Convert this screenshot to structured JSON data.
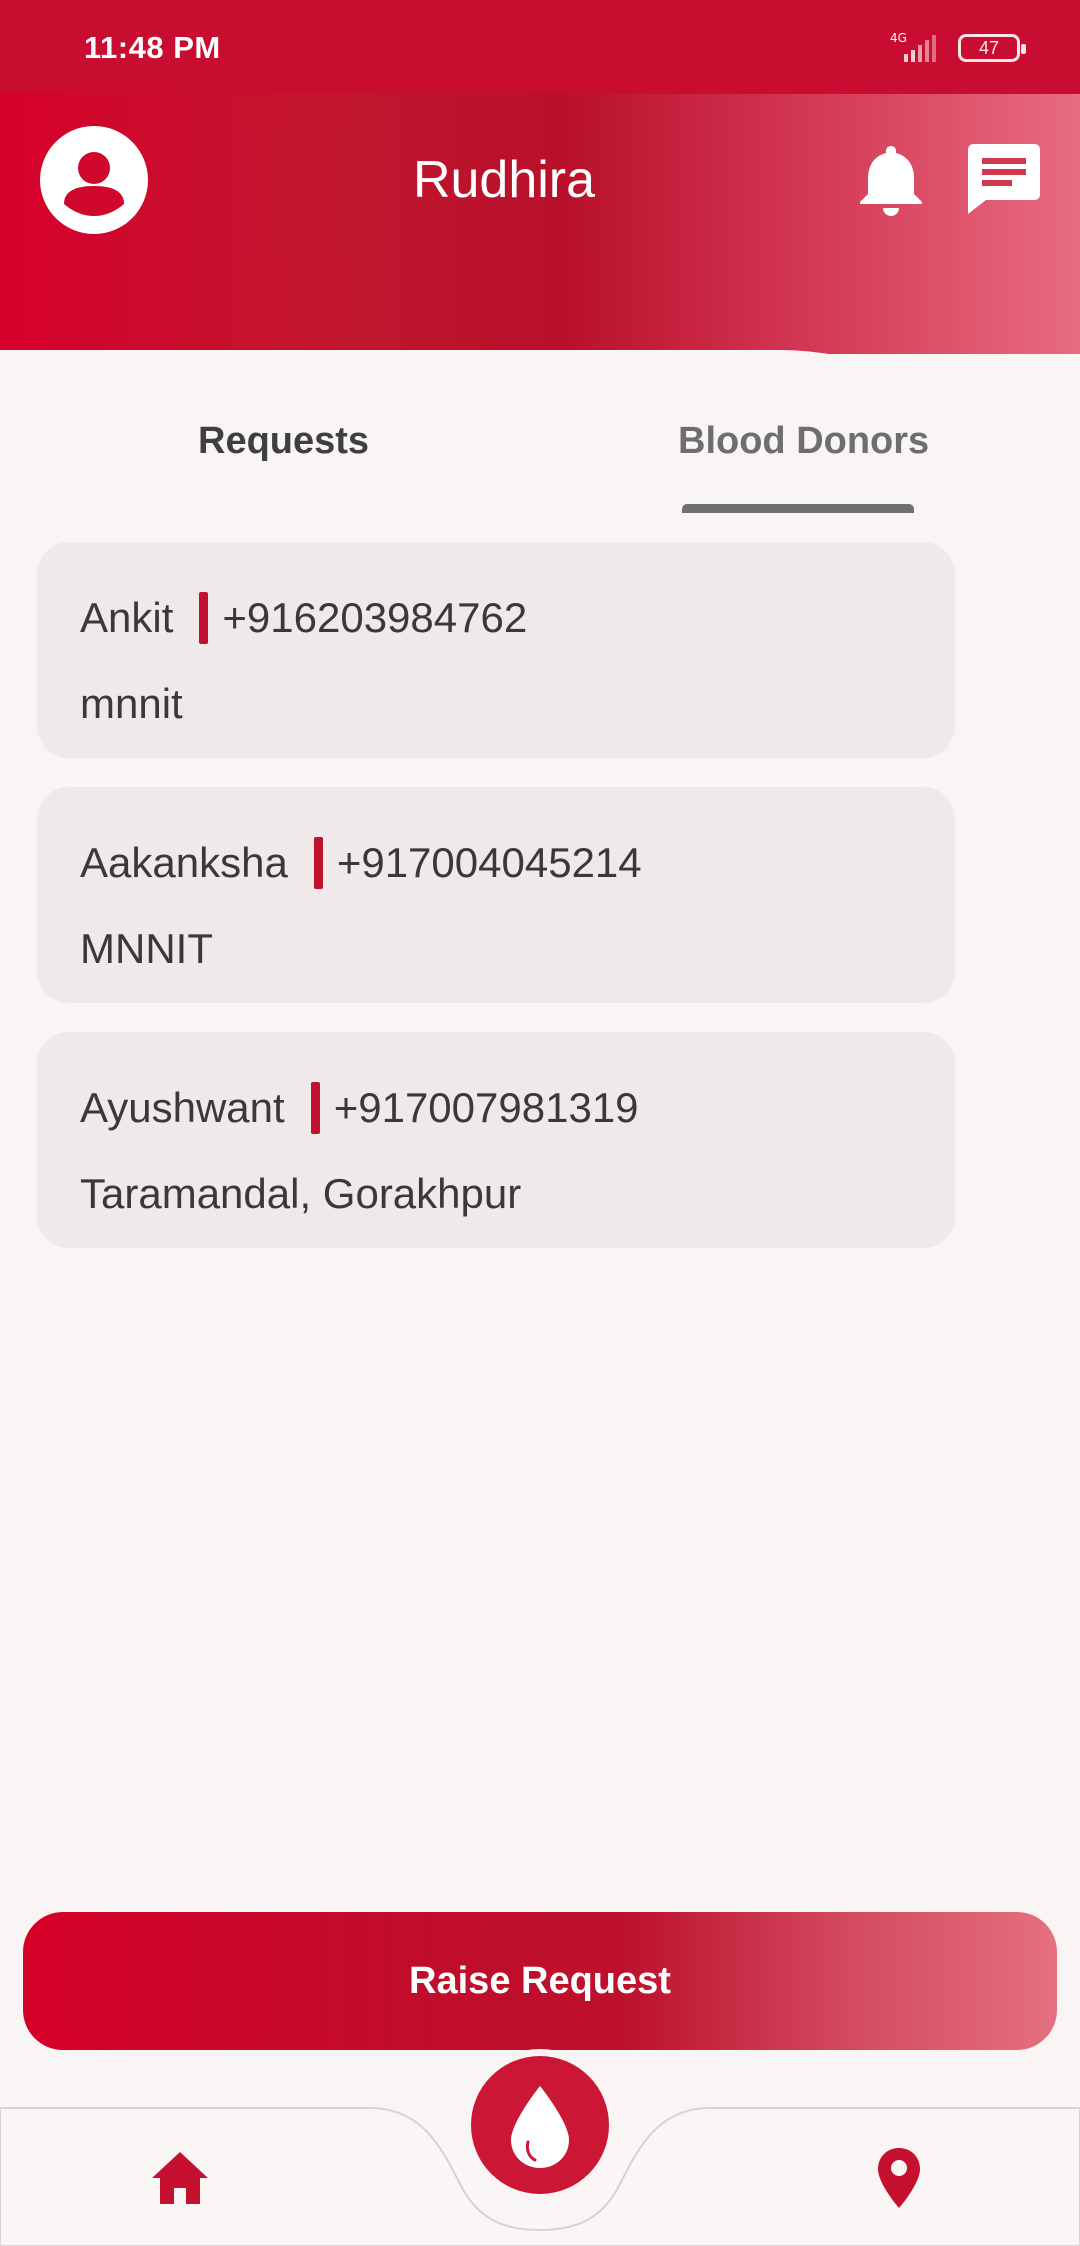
{
  "status_bar": {
    "time": "11:48 PM",
    "network": "4G",
    "battery": "47"
  },
  "header": {
    "title": "Rudhira",
    "avatar_icon": "user-avatar-icon",
    "notification_icon": "bell-icon",
    "message_icon": "chat-icon"
  },
  "tabs": [
    {
      "label": "Requests",
      "selected": false
    },
    {
      "label": "Blood Donors",
      "selected": true
    }
  ],
  "requests": [
    {
      "name": "Ankit",
      "phone": "+916203984762",
      "location": "mnnit"
    },
    {
      "name": "Aakanksha",
      "phone": "+917004045214",
      "location": "MNNIT"
    },
    {
      "name": "Ayushwant",
      "phone": "+917007981319",
      "location": "Taramandal, Gorakhpur"
    }
  ],
  "actions": {
    "raise_request_label": "Raise Request"
  },
  "bottom_nav": {
    "left_icon": "home-icon",
    "center_icon": "blood-drop-icon",
    "right_icon": "location-pin-icon"
  },
  "colors": {
    "brand_red": "#c90d30",
    "card_bg": "#efe9ea",
    "accent_bar": "#c0122f"
  }
}
